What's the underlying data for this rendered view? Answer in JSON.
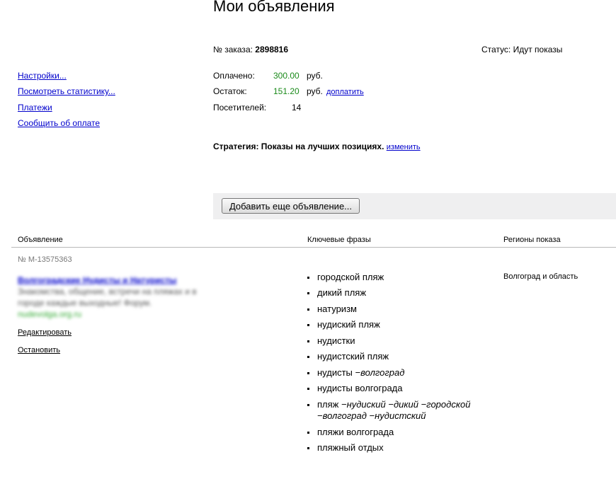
{
  "page_title": "Мои объявления",
  "order": {
    "label": "№ заказа:",
    "number": "2898816",
    "status": "Статус: Идут показы"
  },
  "sidebar": {
    "links": [
      {
        "label": "Настройки..."
      },
      {
        "label": "Посмотреть статистику..."
      },
      {
        "label": "Платежи"
      },
      {
        "label": "Сообщить об оплате"
      }
    ]
  },
  "stats": {
    "paid_label": "Оплачено:",
    "paid_value": "300.00",
    "currency": "руб.",
    "balance_label": "Остаток:",
    "balance_value": "151.20",
    "topup_link": "доплатить",
    "visitors_label": "Посетителей:",
    "visitors_value": "14"
  },
  "strategy": {
    "text": "Стратегия: Показы на лучших позициях.",
    "change_link": "изменить"
  },
  "toolbar": {
    "add_button": "Добавить еще объявление..."
  },
  "table": {
    "headers": [
      "Объявление",
      "Ключевые фразы",
      "Регионы показа"
    ],
    "ad": {
      "id": "№ M-13575363",
      "title": "Волгоградские Нудисты и Натуристы",
      "text": "Знакомства, общение, встречи на пляжах и в городе каждые выходные! Форум.",
      "url": "nudevolga.org.ru",
      "edit": "Редактировать",
      "stop": "Остановить",
      "region": "Волгоград и область",
      "keywords": [
        {
          "main": "городской пляж",
          "minus": ""
        },
        {
          "main": "дикий пляж",
          "minus": ""
        },
        {
          "main": "натуризм",
          "minus": ""
        },
        {
          "main": "нудиский пляж",
          "minus": ""
        },
        {
          "main": "нудистки",
          "minus": ""
        },
        {
          "main": "нудистский пляж",
          "minus": ""
        },
        {
          "main": "нудисты",
          "minus": "−волгоград"
        },
        {
          "main": "нудисты волгограда",
          "minus": ""
        },
        {
          "main": "пляж",
          "minus": "−нудиский −дикий −городской",
          "minus2": "−волгоград −нудистский"
        },
        {
          "main": "пляжи волгограда",
          "minus": ""
        },
        {
          "main": "пляжный отдых",
          "minus": ""
        }
      ]
    }
  },
  "colors": {
    "money": "#1a8a1a",
    "link": "#0000cc",
    "toolbar_bg": "#efeff0"
  }
}
